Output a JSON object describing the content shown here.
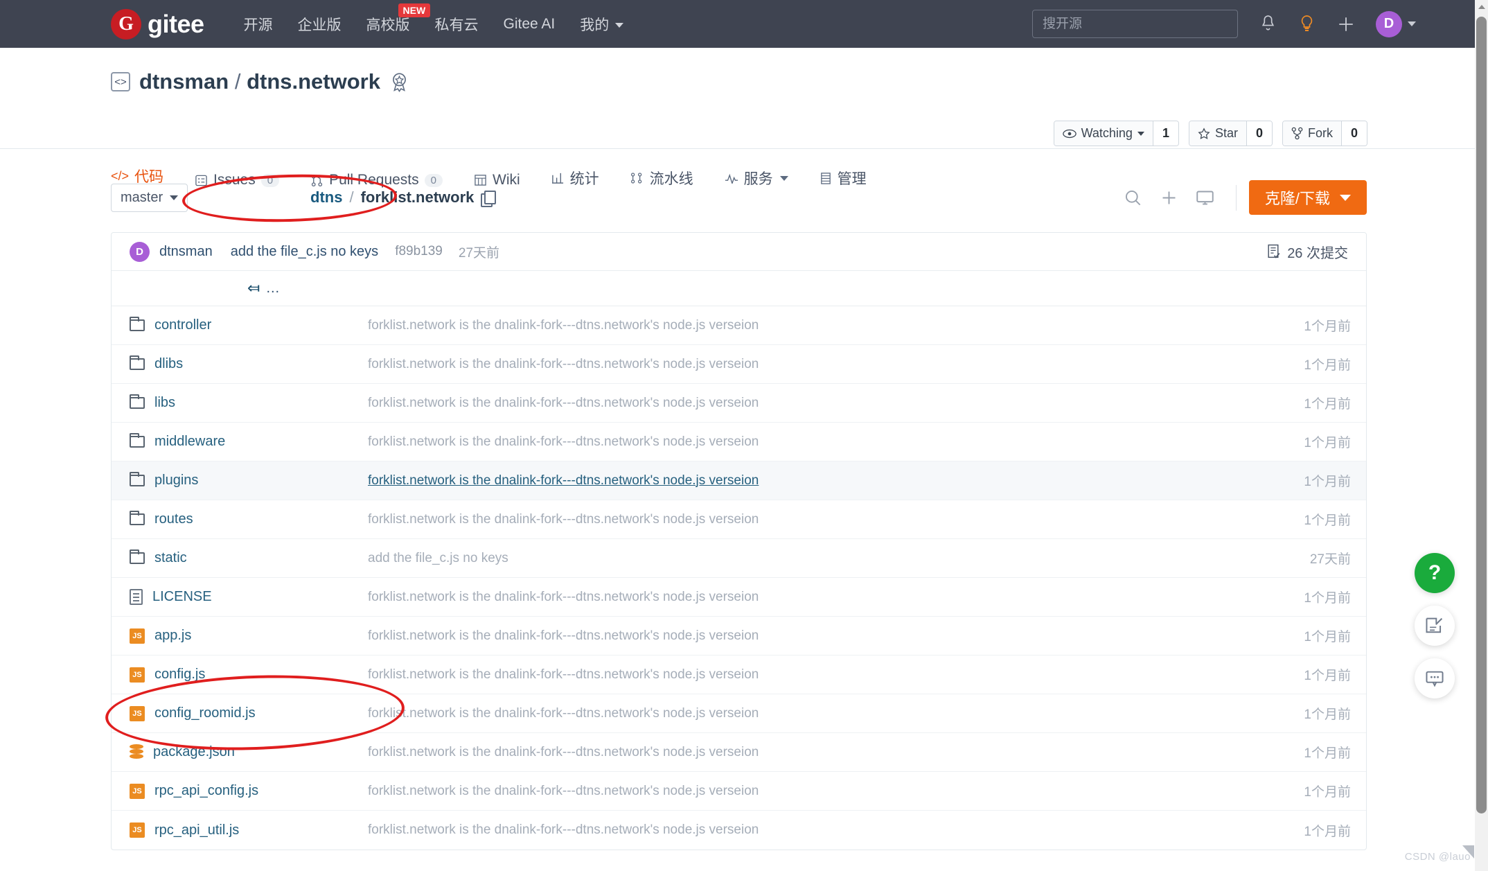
{
  "topnav": {
    "brand": "gitee",
    "brand_glyph": "G",
    "links": [
      {
        "label": "开源",
        "caret": false
      },
      {
        "label": "企业版",
        "caret": false
      },
      {
        "label": "高校版",
        "caret": false
      },
      {
        "label": "私有云",
        "caret": false
      },
      {
        "label": "Gitee AI",
        "caret": false
      },
      {
        "label": "我的",
        "caret": true
      }
    ],
    "new_badge": "NEW",
    "search_placeholder": "搜开源",
    "avatar_letter": "D",
    "icons": [
      "bell-icon",
      "lightbulb-icon",
      "plus-icon"
    ]
  },
  "repo": {
    "owner": "dtnsman",
    "separator": "/",
    "name": "dtns.network",
    "badge_icon": "award-icon",
    "actions": [
      {
        "label": "Watching",
        "count": "1",
        "icon": "eye-icon",
        "caret": true
      },
      {
        "label": "Star",
        "count": "0",
        "icon": "star-icon",
        "caret": false
      },
      {
        "label": "Fork",
        "count": "0",
        "icon": "fork-icon",
        "caret": false
      }
    ],
    "tabs": [
      {
        "label": "代码",
        "icon": "code-icon",
        "badge": null,
        "active": true,
        "caret": false
      },
      {
        "label": "Issues",
        "icon": "issue-icon",
        "badge": "0",
        "active": false,
        "caret": false
      },
      {
        "label": "Pull Requests",
        "icon": "pr-icon",
        "badge": "0",
        "active": false,
        "caret": false
      },
      {
        "label": "Wiki",
        "icon": "wiki-icon",
        "badge": null,
        "active": false,
        "caret": false
      },
      {
        "label": "统计",
        "icon": "chart-icon",
        "badge": null,
        "active": false,
        "caret": false
      },
      {
        "label": "流水线",
        "icon": "pipeline-icon",
        "badge": null,
        "active": false,
        "caret": false
      },
      {
        "label": "服务",
        "icon": "service-icon",
        "badge": null,
        "active": false,
        "caret": true
      },
      {
        "label": "管理",
        "icon": "manage-icon",
        "badge": null,
        "active": false,
        "caret": false
      }
    ]
  },
  "toolbar": {
    "branch": "master",
    "breadcrumb_root": "dtns",
    "breadcrumb_sep": "/",
    "breadcrumb_current": "forklist.network",
    "clone_label": "克隆/下载",
    "icons": [
      "search-icon",
      "plus-icon",
      "terminal-icon"
    ]
  },
  "commit": {
    "avatar_letter": "D",
    "author": "dtnsman",
    "message": "add the file_c.js no keys",
    "sha": "f89b139",
    "when": "27天前",
    "count_label": "26 次提交"
  },
  "parent_row": {
    "dots": "..."
  },
  "files": [
    {
      "name": "controller",
      "type": "folder",
      "desc": "forklist.network is the dnalink-fork---dtns.network's node.js verseion",
      "date": "1个月前",
      "highlight": false
    },
    {
      "name": "dlibs",
      "type": "folder",
      "desc": "forklist.network is the dnalink-fork---dtns.network's node.js verseion",
      "date": "1个月前",
      "highlight": false
    },
    {
      "name": "libs",
      "type": "folder",
      "desc": "forklist.network is the dnalink-fork---dtns.network's node.js verseion",
      "date": "1个月前",
      "highlight": false
    },
    {
      "name": "middleware",
      "type": "folder",
      "desc": "forklist.network is the dnalink-fork---dtns.network's node.js verseion",
      "date": "1个月前",
      "highlight": false
    },
    {
      "name": "plugins",
      "type": "folder",
      "desc": "forklist.network is the dnalink-fork---dtns.network's node.js verseion",
      "date": "1个月前",
      "highlight": true
    },
    {
      "name": "routes",
      "type": "folder",
      "desc": "forklist.network is the dnalink-fork---dtns.network's node.js verseion",
      "date": "1个月前",
      "highlight": false
    },
    {
      "name": "static",
      "type": "folder",
      "desc": "add the file_c.js no keys",
      "date": "27天前",
      "highlight": false
    },
    {
      "name": "LICENSE",
      "type": "doc",
      "desc": "forklist.network is the dnalink-fork---dtns.network's node.js verseion",
      "date": "1个月前",
      "highlight": false
    },
    {
      "name": "app.js",
      "type": "js",
      "desc": "forklist.network is the dnalink-fork---dtns.network's node.js verseion",
      "date": "1个月前",
      "highlight": false
    },
    {
      "name": "config.js",
      "type": "js",
      "desc": "forklist.network is the dnalink-fork---dtns.network's node.js verseion",
      "date": "1个月前",
      "highlight": false
    },
    {
      "name": "config_roomid.js",
      "type": "js",
      "desc": "forklist.network is the dnalink-fork---dtns.network's node.js verseion",
      "date": "1个月前",
      "highlight": false
    },
    {
      "name": "package.json",
      "type": "json",
      "desc": "forklist.network is the dnalink-fork---dtns.network's node.js verseion",
      "date": "1个月前",
      "highlight": false
    },
    {
      "name": "rpc_api_config.js",
      "type": "js",
      "desc": "forklist.network is the dnalink-fork---dtns.network's node.js verseion",
      "date": "1个月前",
      "highlight": false
    },
    {
      "name": "rpc_api_util.js",
      "type": "js",
      "desc": "forklist.network is the dnalink-fork---dtns.network's node.js verseion",
      "date": "1个月前",
      "highlight": false
    }
  ],
  "js_icon_label": "JS",
  "float_buttons": [
    {
      "icon": "question-mark-icon",
      "label": "?",
      "style": "green"
    },
    {
      "icon": "feedback-edit-icon",
      "label": "",
      "style": "white"
    },
    {
      "icon": "chat-bubble-icon",
      "label": "",
      "style": "white"
    }
  ],
  "watermark": "CSDN @lauo",
  "colors": {
    "nav_bg": "#3f4451",
    "brand_red": "#c71d23",
    "accent_orange": "#e8520e",
    "clone_orange": "#f06a12",
    "link_blue": "#26607f",
    "annotation_red": "#e01e1e",
    "js_icon": "#eb8c22",
    "avatar_purple": "#a85ed6"
  }
}
